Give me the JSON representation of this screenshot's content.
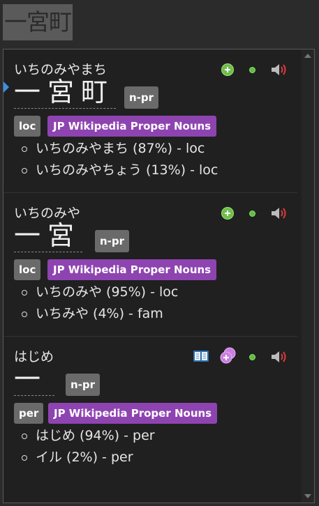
{
  "source": {
    "word": "一宮町"
  },
  "entries": [
    {
      "reading": "いちのみやまち",
      "kanji": "一宮町",
      "pos": "n-pr",
      "tags": [
        "loc",
        "JP Wikipedia Proper Nouns"
      ],
      "definitions": [
        "いちのみやまち (87%) - loc",
        "いちのみやちょう (13%) - loc"
      ]
    },
    {
      "reading": "いちのみや",
      "kanji": "一宮",
      "pos": "n-pr",
      "tags": [
        "loc",
        "JP Wikipedia Proper Nouns"
      ],
      "definitions": [
        "いちのみや (95%) - loc",
        "いちみや (4%) - fam"
      ]
    },
    {
      "reading": "はじめ",
      "kanji": "一",
      "pos": "n-pr",
      "tags": [
        "per",
        "JP Wikipedia Proper Nouns"
      ],
      "definitions": [
        "はじめ (94%) - per",
        "イル (2%) - per"
      ]
    }
  ],
  "icons": {
    "add": "add-note-icon",
    "dot": "status-dot-icon",
    "audio": "speaker-icon",
    "book": "book-icon",
    "multi_add": "duplicate-add-icon"
  },
  "colors": {
    "wiki_tag": "#8e44b0",
    "tag": "#6a6a6a",
    "add_icon": "#6fbe4a",
    "pointer": "#3d8fe0"
  }
}
